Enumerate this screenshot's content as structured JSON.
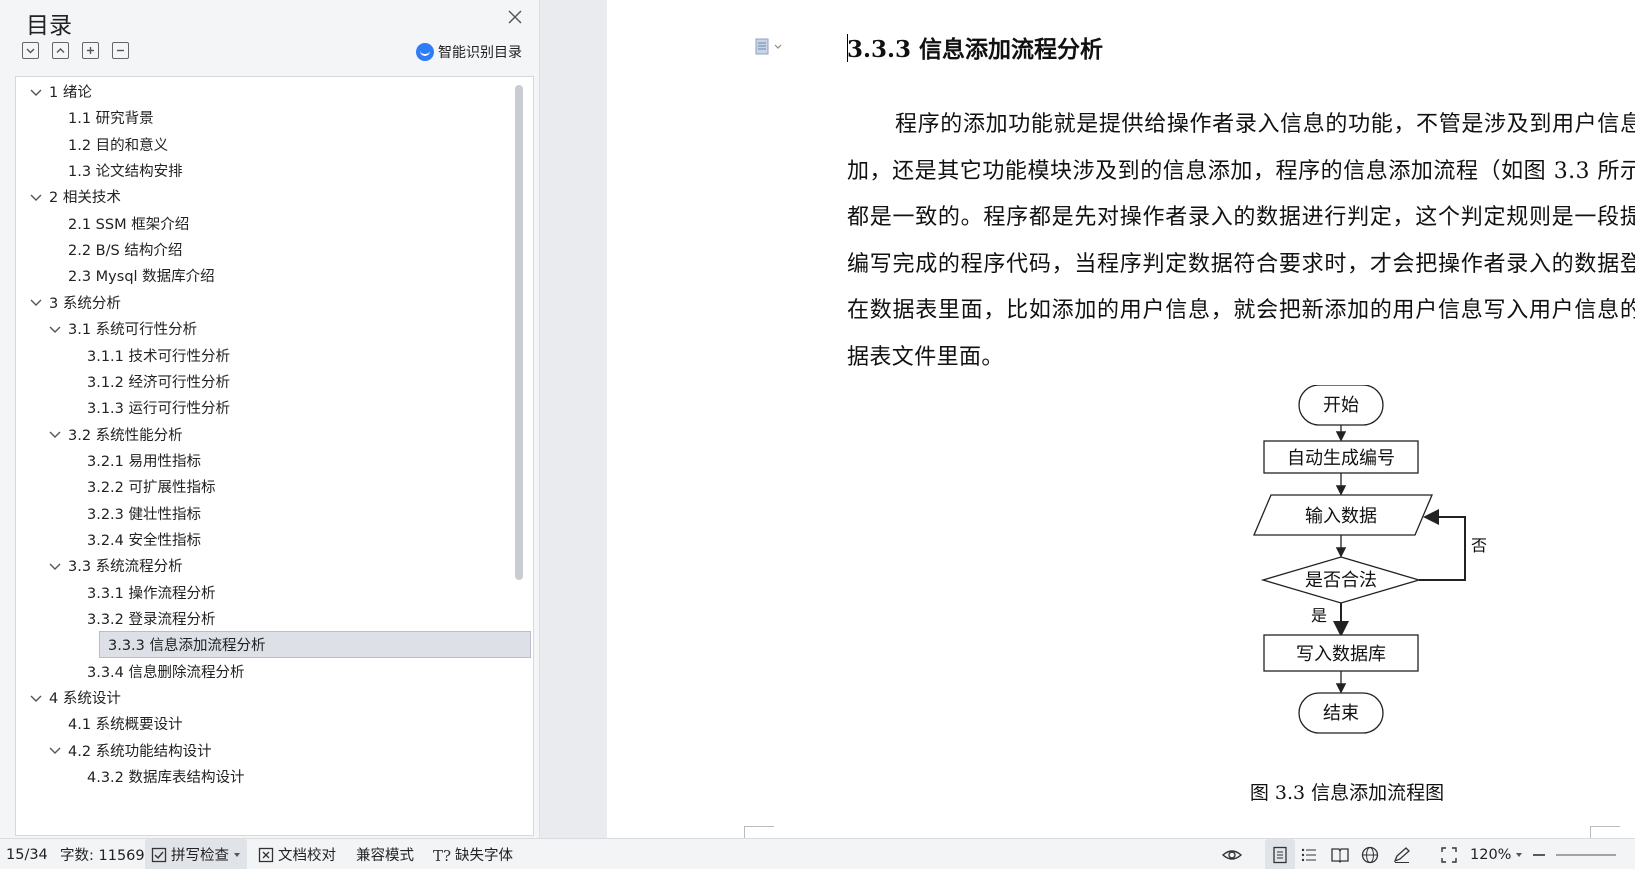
{
  "toc": {
    "title": "目录",
    "smart_label": "智能识别目录",
    "items": [
      {
        "label": "1  绪论",
        "level": 1,
        "chev": true
      },
      {
        "label": "1.1  研究背景",
        "level": 2,
        "chev": false
      },
      {
        "label": "1.2  目的和意义",
        "level": 2,
        "chev": false
      },
      {
        "label": "1.3  论文结构安排",
        "level": 2,
        "chev": false
      },
      {
        "label": "2  相关技术",
        "level": 1,
        "chev": true
      },
      {
        "label": "2.1 SSM 框架介绍",
        "level": 2,
        "chev": false
      },
      {
        "label": "2.2 B/S 结构介绍",
        "level": 2,
        "chev": false
      },
      {
        "label": "2.3 Mysql 数据库介绍",
        "level": 2,
        "chev": false
      },
      {
        "label": "3  系统分析",
        "level": 1,
        "chev": true
      },
      {
        "label": "3.1  系统可行性分析",
        "level": 2,
        "chev": true
      },
      {
        "label": "3.1.1  技术可行性分析",
        "level": 3,
        "chev": false
      },
      {
        "label": "3.1.2  经济可行性分析",
        "level": 3,
        "chev": false
      },
      {
        "label": "3.1.3  运行可行性分析",
        "level": 3,
        "chev": false
      },
      {
        "label": "3.2  系统性能分析",
        "level": 2,
        "chev": true
      },
      {
        "label": "3.2.1  易用性指标",
        "level": 3,
        "chev": false
      },
      {
        "label": "3.2.2  可扩展性指标",
        "level": 3,
        "chev": false
      },
      {
        "label": "3.2.3  健壮性指标",
        "level": 3,
        "chev": false
      },
      {
        "label": "3.2.4  安全性指标",
        "level": 3,
        "chev": false
      },
      {
        "label": "3.3  系统流程分析",
        "level": 2,
        "chev": true
      },
      {
        "label": "3.3.1  操作流程分析",
        "level": 3,
        "chev": false
      },
      {
        "label": "3.3.2  登录流程分析",
        "level": 3,
        "chev": false
      },
      {
        "label": "3.3.3  信息添加流程分析",
        "level": 3,
        "chev": false,
        "selected": true
      },
      {
        "label": "3.3.4  信息删除流程分析",
        "level": 3,
        "chev": false
      },
      {
        "label": "4  系统设计",
        "level": 1,
        "chev": true
      },
      {
        "label": "4.1  系统概要设计",
        "level": 2,
        "chev": false
      },
      {
        "label": "4.2  系统功能结构设计",
        "level": 2,
        "chev": true
      },
      {
        "label": "4.3.2  数据库表结构设计",
        "level": 3,
        "chev": false
      }
    ]
  },
  "doc": {
    "heading": "3.3.3  信息添加流程分析",
    "paragraph": "程序的添加功能就是提供给操作者录入信息的功能，不管是涉及到用户信息添加，还是其它功能模块涉及到的信息添加，程序的信息添加流程（如图 3.3 所示）都是一致的。程序都是先对操作者录入的数据进行判定，这个判定规则是一段提前编写完成的程序代码，当程序判定数据符合要求时，才会把操作者录入的数据登记在数据表里面，比如添加的用户信息，就会把新添加的用户信息写入用户信息的数据表文件里面。",
    "flow": {
      "start": "开始",
      "step1": "自动生成编号",
      "input": "输入数据",
      "decision": "是否合法",
      "no": "否",
      "yes": "是",
      "write": "写入数据库",
      "end": "结束"
    },
    "caption": "图 3.3  信息添加流程图"
  },
  "status": {
    "page": "15/34",
    "words": "字数: 11569",
    "spell": "拼写检查",
    "proof": "文档校对",
    "compat": "兼容模式",
    "missing_font": "缺失字体",
    "zoom": "120%"
  },
  "colors": {
    "accent": "#2e7cf6",
    "selected_bg": "#dde1e7"
  }
}
